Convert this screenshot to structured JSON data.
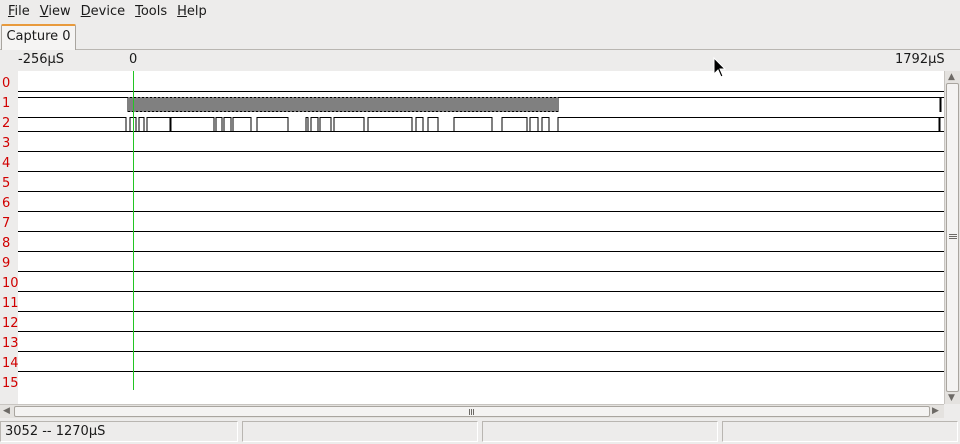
{
  "menu": [
    {
      "label": "File",
      "mnemonic": "F",
      "rest": "ile"
    },
    {
      "label": "View",
      "mnemonic": "V",
      "rest": "iew"
    },
    {
      "label": "Device",
      "mnemonic": "D",
      "rest": "evice"
    },
    {
      "label": "Tools",
      "mnemonic": "T",
      "rest": "ools"
    },
    {
      "label": "Help",
      "mnemonic": "H",
      "rest": "elp"
    }
  ],
  "tab": {
    "label": "Capture 0"
  },
  "ruler": {
    "start": "-256µS",
    "zero": "0",
    "end": "1792µS"
  },
  "channels": [
    "0",
    "1",
    "2",
    "3",
    "4",
    "5",
    "6",
    "7",
    "8",
    "9",
    "10",
    "11",
    "12",
    "13",
    "14",
    "15"
  ],
  "status": {
    "range": "3052 -- 1270µS"
  },
  "colors": {
    "marker": "#22c522",
    "channel_label": "#d10000",
    "tab_accent": "#e89a3c"
  }
}
